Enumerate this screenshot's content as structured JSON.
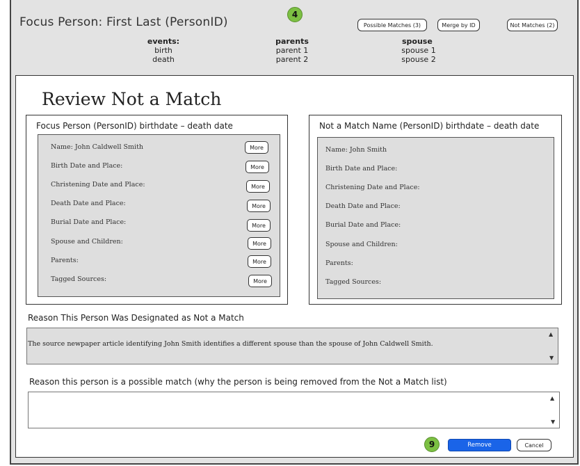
{
  "header": {
    "title": "Focus Person: First  Last  (PersonID)",
    "step_badge": "4",
    "buttons": {
      "possible_matches": "Possible Matches (3)",
      "merge_by_id": "Merge by ID",
      "not_matches": "Not Matches (2)"
    },
    "events": {
      "heading": "events:",
      "items": [
        "birth",
        "death"
      ]
    },
    "parents": {
      "heading": "parents",
      "items": [
        "parent 1",
        "parent 2"
      ]
    },
    "spouse": {
      "heading": "spouse",
      "items": [
        "spouse 1",
        "spouse 2"
      ]
    }
  },
  "page_title": "Review Not a Match",
  "focus_panel": {
    "title": "Focus Person (PersonID)   birthdate – death date",
    "more_label": "More",
    "fields": [
      "Name: John Caldwell Smith",
      "Birth Date and Place:",
      "Christening Date and Place:",
      "Death Date and Place:",
      "Burial Date and Place:",
      "Spouse and Children:",
      "Parents:",
      "Tagged Sources:"
    ]
  },
  "match_panel": {
    "title": "Not a Match Name (PersonID) birthdate – death date",
    "fields": [
      "Name: John Smith",
      "Birth Date and Place:",
      "Christening Date and Place:",
      "Death Date and Place:",
      "Burial Date and Place:",
      "Spouse and Children:",
      "Parents:",
      "Tagged Sources:"
    ]
  },
  "reason_not_match": {
    "label": "Reason This Person Was Designated as Not a Match",
    "text": "The source newpaper article identifying John Smith identifies a different spouse than the spouse of John Caldwell Smith."
  },
  "reason_possible_match": {
    "label": "Reason this person is a possible match (why the person is being removed from the Not a Match list)",
    "value": ""
  },
  "footer": {
    "step_badge": "9",
    "remove_label": "Remove",
    "cancel_label": "Cancel"
  },
  "colors": {
    "badge": "#7cc043",
    "remove_button": "#1a64e8",
    "frame_bg": "#e3e3e3"
  }
}
